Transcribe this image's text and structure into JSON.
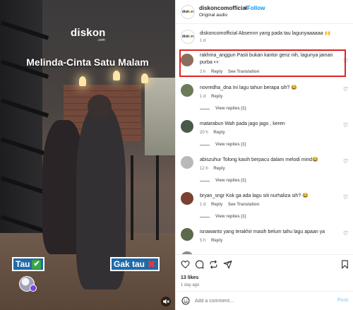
{
  "video": {
    "brand": "diskon",
    "brand_sub": ".com",
    "title": "Melinda-Cinta Satu Malam",
    "poll_yes_label": "Tau",
    "poll_yes_mark": "✔",
    "poll_no_label": "Gak tau",
    "poll_no_mark": "✖",
    "mute_icon": "speaker-muted-icon"
  },
  "header": {
    "username": "diskoncomofficial",
    "separator": "•",
    "follow_label": "Follow",
    "audio": "Original audio",
    "logo_text": "diskon"
  },
  "caption": {
    "text": "diskoncomofficial Absennn yang pada tau lagunyaaaaaa 🙌",
    "time": "1 d"
  },
  "comments": [
    {
      "username": "rakhma_anggun",
      "text": "Pasti bukan kantor genz nih, lagunya jaman purba 👀",
      "time": "2 h",
      "reply": "Reply",
      "extra": "See Translation",
      "avatar_color": "#8a6d5c",
      "highlighted": true
    },
    {
      "username": "novredha_dna",
      "text": "Ini lagu tahun berapa sih? 😂",
      "time": "1 d",
      "reply": "Reply",
      "extra": "",
      "replies": "View replies (1)",
      "avatar_color": "#6c7a5a"
    },
    {
      "username": "matarabun",
      "text": "Wah pada jago jago , keren",
      "time": "20 h",
      "reply": "Reply",
      "extra": "",
      "replies": "View replies (1)",
      "avatar_color": "#4a5a48"
    },
    {
      "username": "abiszuhur",
      "text": "Tolong kasih berpacu dalam melodi mind😂",
      "time": "12 h",
      "reply": "Reply",
      "extra": "",
      "replies": "View replies (1)",
      "avatar_color": "#b9b9b9"
    },
    {
      "username": "bryan_sngr",
      "text": "Kok ga ada lagu siti nurhaliza sih? 😂",
      "time": "1 d",
      "reply": "Reply",
      "extra": "See Translation",
      "replies": "View replies (1)",
      "avatar_color": "#7a4032"
    },
    {
      "username": "isnawanto",
      "text": "yang terakhir masih belum tahu lagu apaan ya",
      "time": "5 h",
      "reply": "Reply",
      "extra": "",
      "avatar_color": "#5c6a4c"
    }
  ],
  "actions": {
    "likes": "13 likes",
    "date": "1 day ago"
  },
  "add_comment": {
    "placeholder": "Add a comment…",
    "post_label": "Post"
  }
}
